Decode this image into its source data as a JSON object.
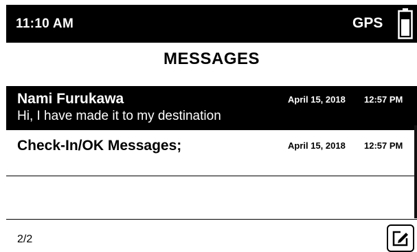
{
  "status_bar": {
    "time": "11:10 AM",
    "gps_label": "GPS",
    "battery_icon": "battery-full-icon"
  },
  "header": {
    "title": "MESSAGES"
  },
  "messages": [
    {
      "sender": "Nami Furukawa",
      "preview": "Hi, I have made it to my destination",
      "date": "April 15, 2018",
      "time": "12:57 PM",
      "selected": true
    },
    {
      "sender": "Check-In/OK Messages;",
      "preview": "",
      "date": "April 15, 2018",
      "time": "12:57 PM",
      "selected": false
    }
  ],
  "footer": {
    "page_indicator": "2/2",
    "compose_icon": "compose-icon"
  },
  "colors": {
    "background": "#ffffff",
    "bar": "#000000",
    "text_inverse": "#ffffff"
  }
}
